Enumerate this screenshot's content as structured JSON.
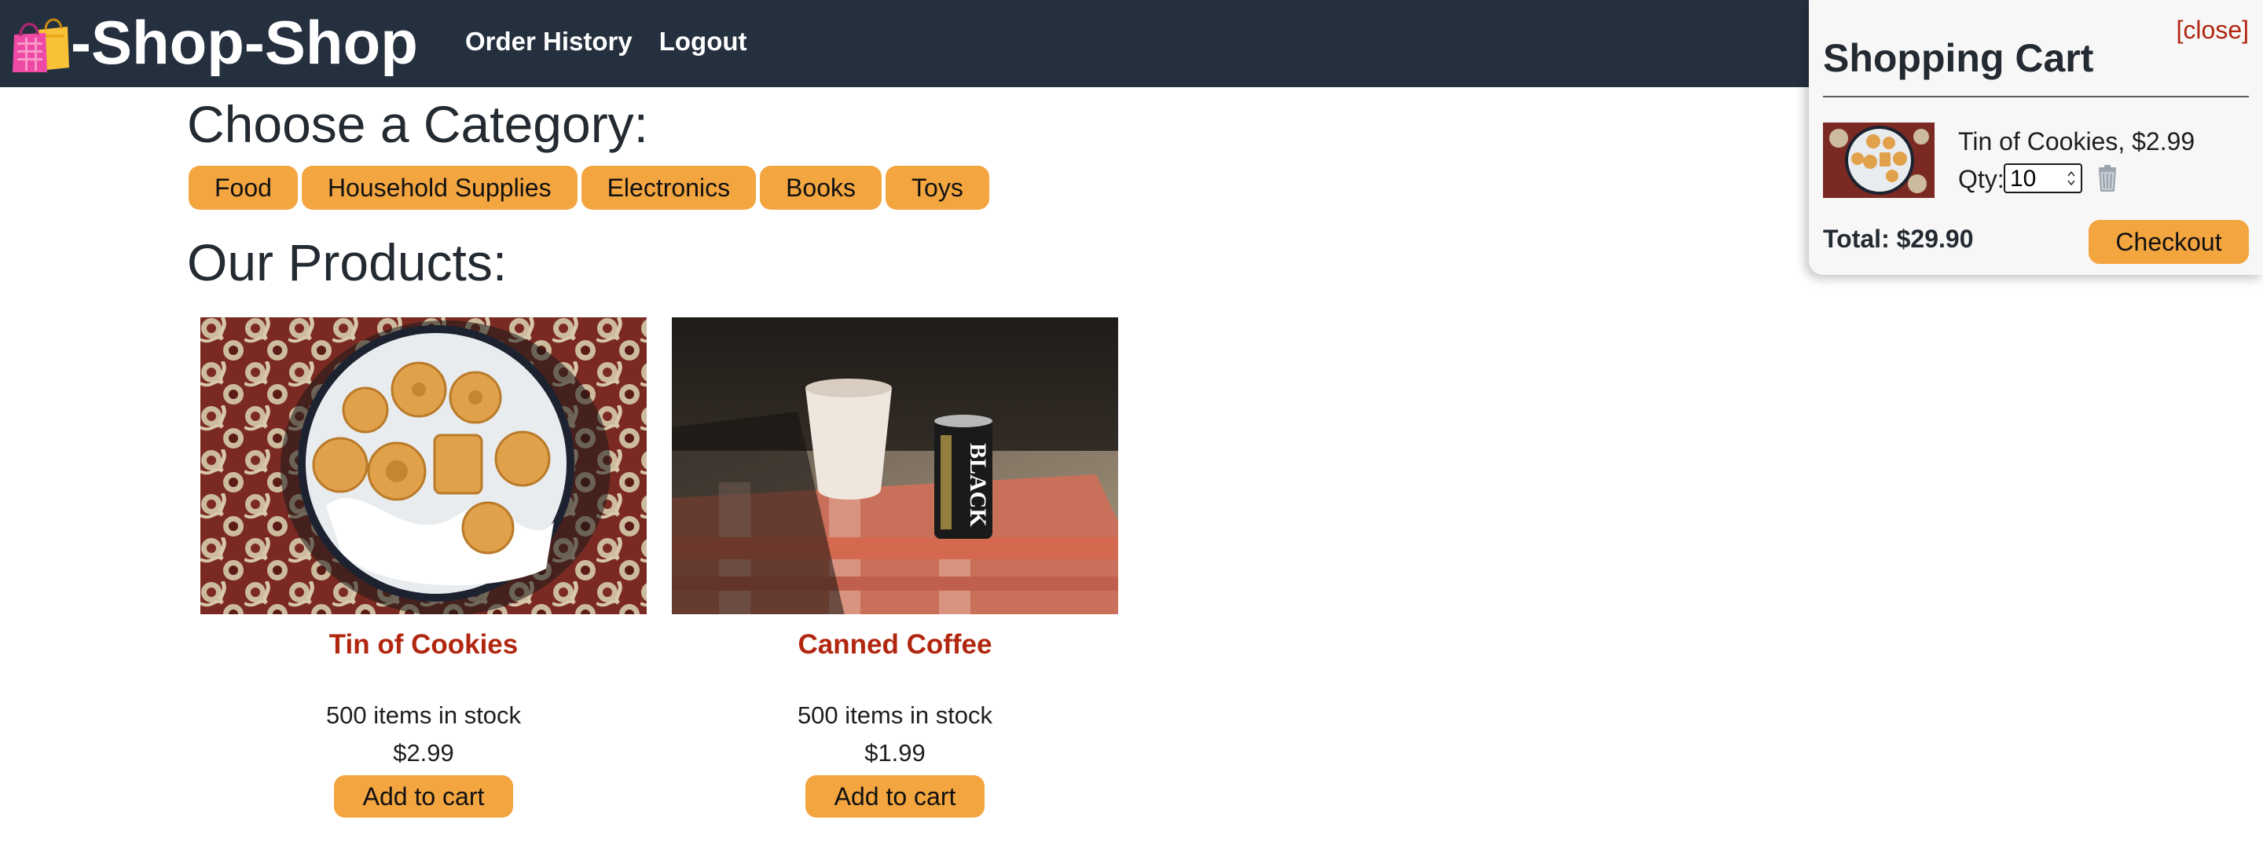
{
  "header": {
    "brand": "-Shop-Shop",
    "logo_icon": "shopping-bags-icon",
    "nav": [
      "Order History",
      "Logout"
    ],
    "background": "#25303f"
  },
  "categories": {
    "heading": "Choose a Category:",
    "items": [
      "Food",
      "Household Supplies",
      "Electronics",
      "Books",
      "Toys"
    ]
  },
  "products": {
    "heading": "Our Products:",
    "items": [
      {
        "name": "Tin of Cookies",
        "stock": "500 items in stock",
        "price": "$2.99",
        "button": "Add to cart"
      },
      {
        "name": "Canned Coffee",
        "stock": "500 items in stock",
        "price": "$1.99",
        "button": "Add to cart"
      }
    ]
  },
  "cart": {
    "close": "[close]",
    "title": "Shopping Cart",
    "item": {
      "label": "Tin of Cookies, $2.99",
      "qty_label": "Qty:",
      "qty": "10"
    },
    "total": "Total: $29.90",
    "checkout": "Checkout"
  },
  "colors": {
    "accent": "#f3a540",
    "title_red": "#b1260f",
    "nav_bg": "#25303f"
  }
}
